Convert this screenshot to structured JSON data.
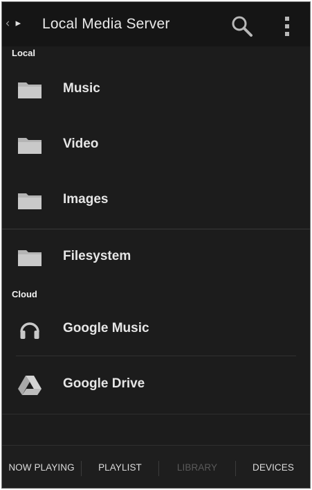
{
  "header": {
    "title": "Local Media Server",
    "back_icon": "chevron-left-icon",
    "app_icon": "play-icon",
    "search_icon": "search-icon",
    "menu_icon": "overflow-menu-icon"
  },
  "sections": {
    "local": {
      "title": "Local",
      "items": [
        {
          "label": "Music",
          "icon": "folder-icon"
        },
        {
          "label": "Video",
          "icon": "folder-icon"
        },
        {
          "label": "Images",
          "icon": "folder-icon"
        },
        {
          "label": "Filesystem",
          "icon": "folder-icon"
        }
      ]
    },
    "cloud": {
      "title": "Cloud",
      "items": [
        {
          "label": "Google Music",
          "icon": "headphones-icon"
        },
        {
          "label": "Google Drive",
          "icon": "google-drive-icon"
        }
      ]
    }
  },
  "tabs": [
    {
      "label": "NOW PLAYING",
      "enabled": true
    },
    {
      "label": "PLAYLIST",
      "enabled": true
    },
    {
      "label": "LIBRARY",
      "enabled": false
    },
    {
      "label": "DEVICES",
      "enabled": true
    }
  ],
  "colors": {
    "background": "#1c1c1c",
    "text": "#e6e6e6",
    "disabled_text": "#5a5a5a",
    "icon": "#bdbdbd"
  }
}
